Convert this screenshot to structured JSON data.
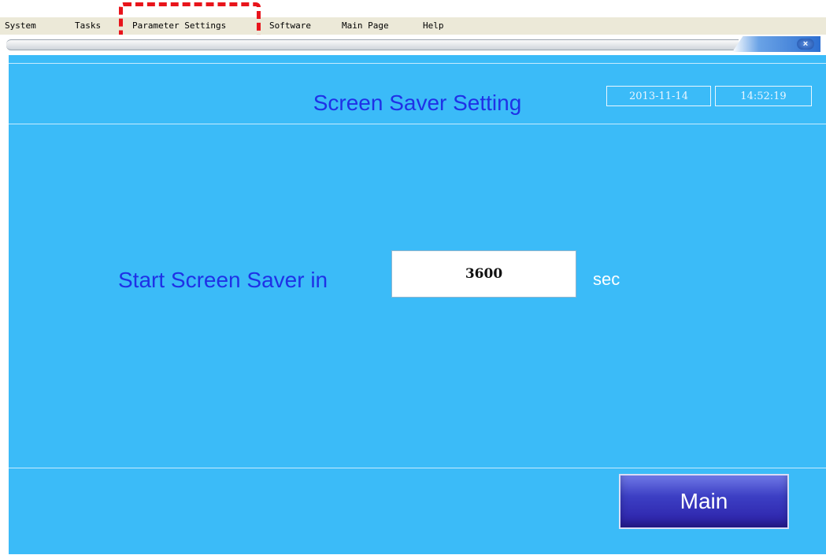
{
  "menu": {
    "items": [
      "System",
      "Tasks",
      "Parameter Settings",
      "Software",
      "Main Page",
      "Help"
    ]
  },
  "window": {
    "close_icon": "close-icon",
    "close_glyph": "×"
  },
  "header": {
    "title": "Screen Saver Setting",
    "date": "2013-11-14",
    "time": "14:52:19"
  },
  "setting": {
    "label": "Start Screen Saver in",
    "value": "3600",
    "unit": "sec"
  },
  "footer": {
    "main_button": "Main"
  },
  "colors": {
    "panel": "#3bbbf8",
    "title_text": "#1f31e6",
    "highlight": "#e8141b",
    "main_button": "#3c3fc4"
  }
}
